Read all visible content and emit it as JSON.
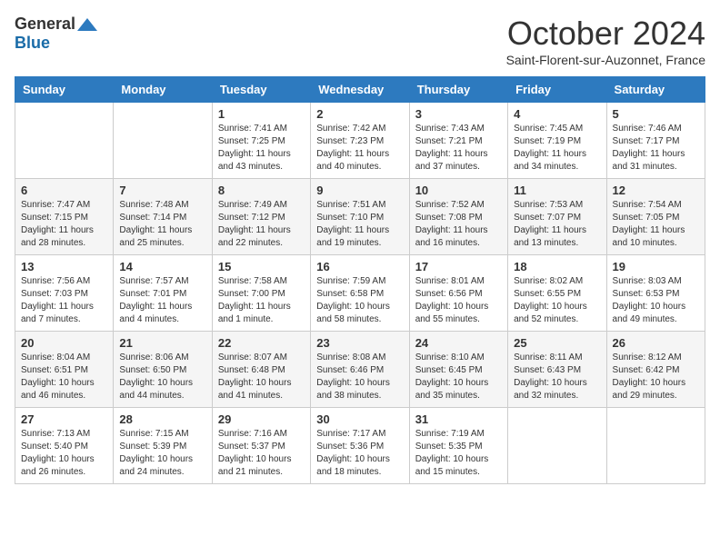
{
  "logo": {
    "general": "General",
    "blue": "Blue"
  },
  "title": "October 2024",
  "location": "Saint-Florent-sur-Auzonnet, France",
  "headers": [
    "Sunday",
    "Monday",
    "Tuesday",
    "Wednesday",
    "Thursday",
    "Friday",
    "Saturday"
  ],
  "weeks": [
    [
      {
        "day": "",
        "info": ""
      },
      {
        "day": "",
        "info": ""
      },
      {
        "day": "1",
        "info": "Sunrise: 7:41 AM\nSunset: 7:25 PM\nDaylight: 11 hours and 43 minutes."
      },
      {
        "day": "2",
        "info": "Sunrise: 7:42 AM\nSunset: 7:23 PM\nDaylight: 11 hours and 40 minutes."
      },
      {
        "day": "3",
        "info": "Sunrise: 7:43 AM\nSunset: 7:21 PM\nDaylight: 11 hours and 37 minutes."
      },
      {
        "day": "4",
        "info": "Sunrise: 7:45 AM\nSunset: 7:19 PM\nDaylight: 11 hours and 34 minutes."
      },
      {
        "day": "5",
        "info": "Sunrise: 7:46 AM\nSunset: 7:17 PM\nDaylight: 11 hours and 31 minutes."
      }
    ],
    [
      {
        "day": "6",
        "info": "Sunrise: 7:47 AM\nSunset: 7:15 PM\nDaylight: 11 hours and 28 minutes."
      },
      {
        "day": "7",
        "info": "Sunrise: 7:48 AM\nSunset: 7:14 PM\nDaylight: 11 hours and 25 minutes."
      },
      {
        "day": "8",
        "info": "Sunrise: 7:49 AM\nSunset: 7:12 PM\nDaylight: 11 hours and 22 minutes."
      },
      {
        "day": "9",
        "info": "Sunrise: 7:51 AM\nSunset: 7:10 PM\nDaylight: 11 hours and 19 minutes."
      },
      {
        "day": "10",
        "info": "Sunrise: 7:52 AM\nSunset: 7:08 PM\nDaylight: 11 hours and 16 minutes."
      },
      {
        "day": "11",
        "info": "Sunrise: 7:53 AM\nSunset: 7:07 PM\nDaylight: 11 hours and 13 minutes."
      },
      {
        "day": "12",
        "info": "Sunrise: 7:54 AM\nSunset: 7:05 PM\nDaylight: 11 hours and 10 minutes."
      }
    ],
    [
      {
        "day": "13",
        "info": "Sunrise: 7:56 AM\nSunset: 7:03 PM\nDaylight: 11 hours and 7 minutes."
      },
      {
        "day": "14",
        "info": "Sunrise: 7:57 AM\nSunset: 7:01 PM\nDaylight: 11 hours and 4 minutes."
      },
      {
        "day": "15",
        "info": "Sunrise: 7:58 AM\nSunset: 7:00 PM\nDaylight: 11 hours and 1 minute."
      },
      {
        "day": "16",
        "info": "Sunrise: 7:59 AM\nSunset: 6:58 PM\nDaylight: 10 hours and 58 minutes."
      },
      {
        "day": "17",
        "info": "Sunrise: 8:01 AM\nSunset: 6:56 PM\nDaylight: 10 hours and 55 minutes."
      },
      {
        "day": "18",
        "info": "Sunrise: 8:02 AM\nSunset: 6:55 PM\nDaylight: 10 hours and 52 minutes."
      },
      {
        "day": "19",
        "info": "Sunrise: 8:03 AM\nSunset: 6:53 PM\nDaylight: 10 hours and 49 minutes."
      }
    ],
    [
      {
        "day": "20",
        "info": "Sunrise: 8:04 AM\nSunset: 6:51 PM\nDaylight: 10 hours and 46 minutes."
      },
      {
        "day": "21",
        "info": "Sunrise: 8:06 AM\nSunset: 6:50 PM\nDaylight: 10 hours and 44 minutes."
      },
      {
        "day": "22",
        "info": "Sunrise: 8:07 AM\nSunset: 6:48 PM\nDaylight: 10 hours and 41 minutes."
      },
      {
        "day": "23",
        "info": "Sunrise: 8:08 AM\nSunset: 6:46 PM\nDaylight: 10 hours and 38 minutes."
      },
      {
        "day": "24",
        "info": "Sunrise: 8:10 AM\nSunset: 6:45 PM\nDaylight: 10 hours and 35 minutes."
      },
      {
        "day": "25",
        "info": "Sunrise: 8:11 AM\nSunset: 6:43 PM\nDaylight: 10 hours and 32 minutes."
      },
      {
        "day": "26",
        "info": "Sunrise: 8:12 AM\nSunset: 6:42 PM\nDaylight: 10 hours and 29 minutes."
      }
    ],
    [
      {
        "day": "27",
        "info": "Sunrise: 7:13 AM\nSunset: 5:40 PM\nDaylight: 10 hours and 26 minutes."
      },
      {
        "day": "28",
        "info": "Sunrise: 7:15 AM\nSunset: 5:39 PM\nDaylight: 10 hours and 24 minutes."
      },
      {
        "day": "29",
        "info": "Sunrise: 7:16 AM\nSunset: 5:37 PM\nDaylight: 10 hours and 21 minutes."
      },
      {
        "day": "30",
        "info": "Sunrise: 7:17 AM\nSunset: 5:36 PM\nDaylight: 10 hours and 18 minutes."
      },
      {
        "day": "31",
        "info": "Sunrise: 7:19 AM\nSunset: 5:35 PM\nDaylight: 10 hours and 15 minutes."
      },
      {
        "day": "",
        "info": ""
      },
      {
        "day": "",
        "info": ""
      }
    ]
  ]
}
